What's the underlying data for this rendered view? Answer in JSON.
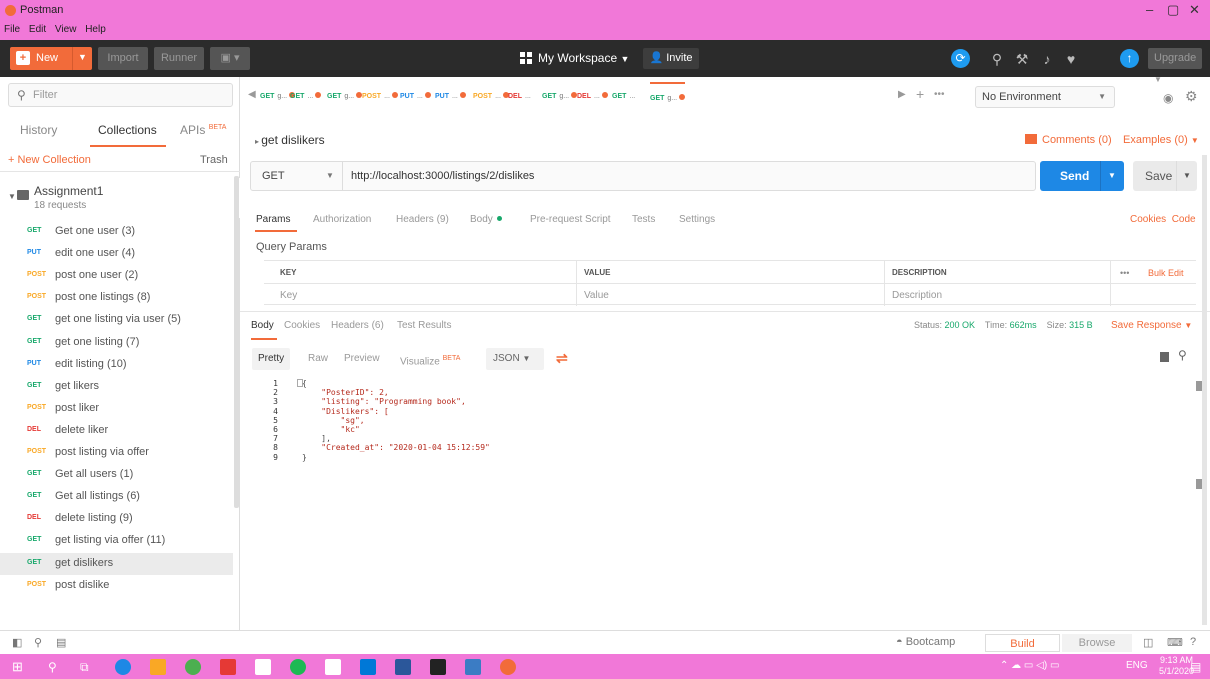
{
  "window": {
    "title": "Postman",
    "menu": [
      "File",
      "Edit",
      "View",
      "Help"
    ]
  },
  "header": {
    "new_label": "New",
    "import_label": "Import",
    "runner_label": "Runner",
    "workspace_label": "My Workspace",
    "invite_label": "Invite",
    "upgrade_label": "Upgrade"
  },
  "sidebar": {
    "filter_placeholder": "Filter",
    "tabs": {
      "history": "History",
      "collections": "Collections",
      "apis": "APIs",
      "apis_badge": "BETA"
    },
    "new_collection": "+ New Collection",
    "trash": "Trash",
    "collection": {
      "name": "Assignment1",
      "count": "18 requests"
    },
    "requests": [
      {
        "method": "GET",
        "name": "Get one user (3)"
      },
      {
        "method": "PUT",
        "name": "edit one user (4)"
      },
      {
        "method": "POST",
        "name": "post one user (2)"
      },
      {
        "method": "POST",
        "name": "post one listings (8)"
      },
      {
        "method": "GET",
        "name": "get one listing via user (5)"
      },
      {
        "method": "GET",
        "name": "get one listing (7)"
      },
      {
        "method": "PUT",
        "name": "edit listing (10)"
      },
      {
        "method": "GET",
        "name": "get likers"
      },
      {
        "method": "POST",
        "name": "post liker"
      },
      {
        "method": "DEL",
        "name": "delete liker"
      },
      {
        "method": "POST",
        "name": "post listing via offer"
      },
      {
        "method": "GET",
        "name": "Get all users (1)"
      },
      {
        "method": "GET",
        "name": "Get all listings (6)"
      },
      {
        "method": "DEL",
        "name": "delete listing (9)"
      },
      {
        "method": "GET",
        "name": "get listing via offer (11)"
      },
      {
        "method": "GET",
        "name": "get dislikers"
      },
      {
        "method": "POST",
        "name": "post dislike"
      }
    ]
  },
  "tabs": [
    {
      "method": "GET",
      "name": "g..."
    },
    {
      "method": "GET",
      "name": "..."
    },
    {
      "method": "GET",
      "name": "g..."
    },
    {
      "method": "POST",
      "name": "..."
    },
    {
      "method": "PUT",
      "name": "..."
    },
    {
      "method": "PUT",
      "name": "..."
    },
    {
      "method": "POST",
      "name": "..."
    },
    {
      "method": "DEL",
      "name": "..."
    },
    {
      "method": "GET",
      "name": "g..."
    },
    {
      "method": "DEL",
      "name": "..."
    },
    {
      "method": "GET",
      "name": "..."
    },
    {
      "method": "GET",
      "name": "g..."
    }
  ],
  "environment": {
    "selected": "No Environment"
  },
  "request": {
    "breadcrumb": "get dislikers",
    "comments": "Comments (0)",
    "examples": "Examples (0)",
    "method": "GET",
    "url": "http://localhost:3000/listings/2/dislikes",
    "send_label": "Send",
    "save_label": "Save",
    "tabs": [
      "Params",
      "Authorization",
      "Headers (9)",
      "Body",
      "Pre-request Script",
      "Tests",
      "Settings"
    ],
    "cookies": "Cookies",
    "code": "Code",
    "query_params_title": "Query Params",
    "columns": [
      "KEY",
      "VALUE",
      "DESCRIPTION"
    ],
    "placeholders": [
      "Key",
      "Value",
      "Description"
    ],
    "more": "•••",
    "bulk_edit": "Bulk Edit"
  },
  "response": {
    "tabs": [
      "Body",
      "Cookies",
      "Headers (6)",
      "Test Results"
    ],
    "status_label": "Status:",
    "status_value": "200 OK",
    "time_label": "Time:",
    "time_value": "662ms",
    "size_label": "Size:",
    "size_value": "315 B",
    "save_response": "Save Response",
    "formats": [
      "Pretty",
      "Raw",
      "Preview",
      "Visualize"
    ],
    "visualize_badge": "BETA",
    "language": "JSON",
    "lines": [
      "{",
      "    \"PosterID\": 2,",
      "    \"listing\": \"Programming book\",",
      "    \"Dislikers\": [",
      "        \"sg\",",
      "        \"kc\"",
      "    ],",
      "    \"Created_at\": \"2020-01-04 15:12:59\"",
      "}"
    ]
  },
  "statusbar": {
    "bootcamp": "Bootcamp",
    "build": "Build",
    "browse": "Browse"
  },
  "taskbar": {
    "lang": "ENG",
    "time": "9:13 AM",
    "date": "5/1/2020"
  },
  "colors": {
    "accent": "#f26b3a",
    "get": "#18a86b",
    "put": "#1e88e5",
    "post": "#f9a825",
    "del": "#e53935",
    "send": "#1e88e5"
  }
}
